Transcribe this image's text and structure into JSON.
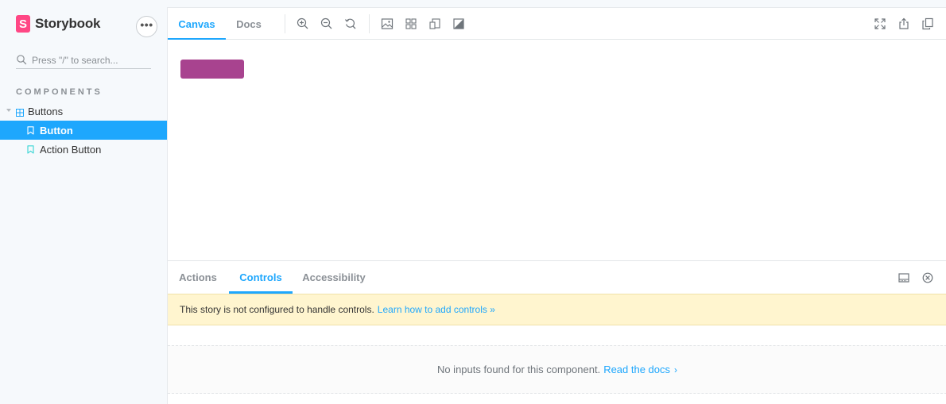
{
  "brand": {
    "logo_letter": "S",
    "name": "Storybook"
  },
  "sidebar": {
    "menu_label": "•••",
    "search_placeholder": "Press \"/\" to search...",
    "section_title": "COMPONENTS",
    "group": {
      "label": "Buttons"
    },
    "stories": [
      {
        "label": "Button",
        "selected": true
      },
      {
        "label": "Action Button",
        "selected": false
      }
    ]
  },
  "toolbar": {
    "tabs": [
      {
        "label": "Canvas",
        "active": true
      },
      {
        "label": "Docs",
        "active": false
      }
    ],
    "left_icons": [
      "zoom-in-icon",
      "zoom-out-icon",
      "zoom-reset-icon",
      "background-icon",
      "grid-icon",
      "viewport-icon",
      "contrast-icon"
    ],
    "right_icons": [
      "fullscreen-icon",
      "share-icon",
      "copy-icon"
    ]
  },
  "addons": {
    "tabs": [
      {
        "label": "Actions",
        "active": false
      },
      {
        "label": "Controls",
        "active": true
      },
      {
        "label": "Accessibility",
        "active": false
      }
    ],
    "notice_text": "This story is not configured to handle controls.",
    "notice_link": "Learn how to add controls »",
    "empty_text": "No inputs found for this component.",
    "empty_link": "Read the docs",
    "chevron": "›"
  },
  "colors": {
    "accent": "#1ea7fd",
    "brand": "#ff4785",
    "story_button": "#a8438f",
    "notice_bg": "#fff5cf"
  }
}
